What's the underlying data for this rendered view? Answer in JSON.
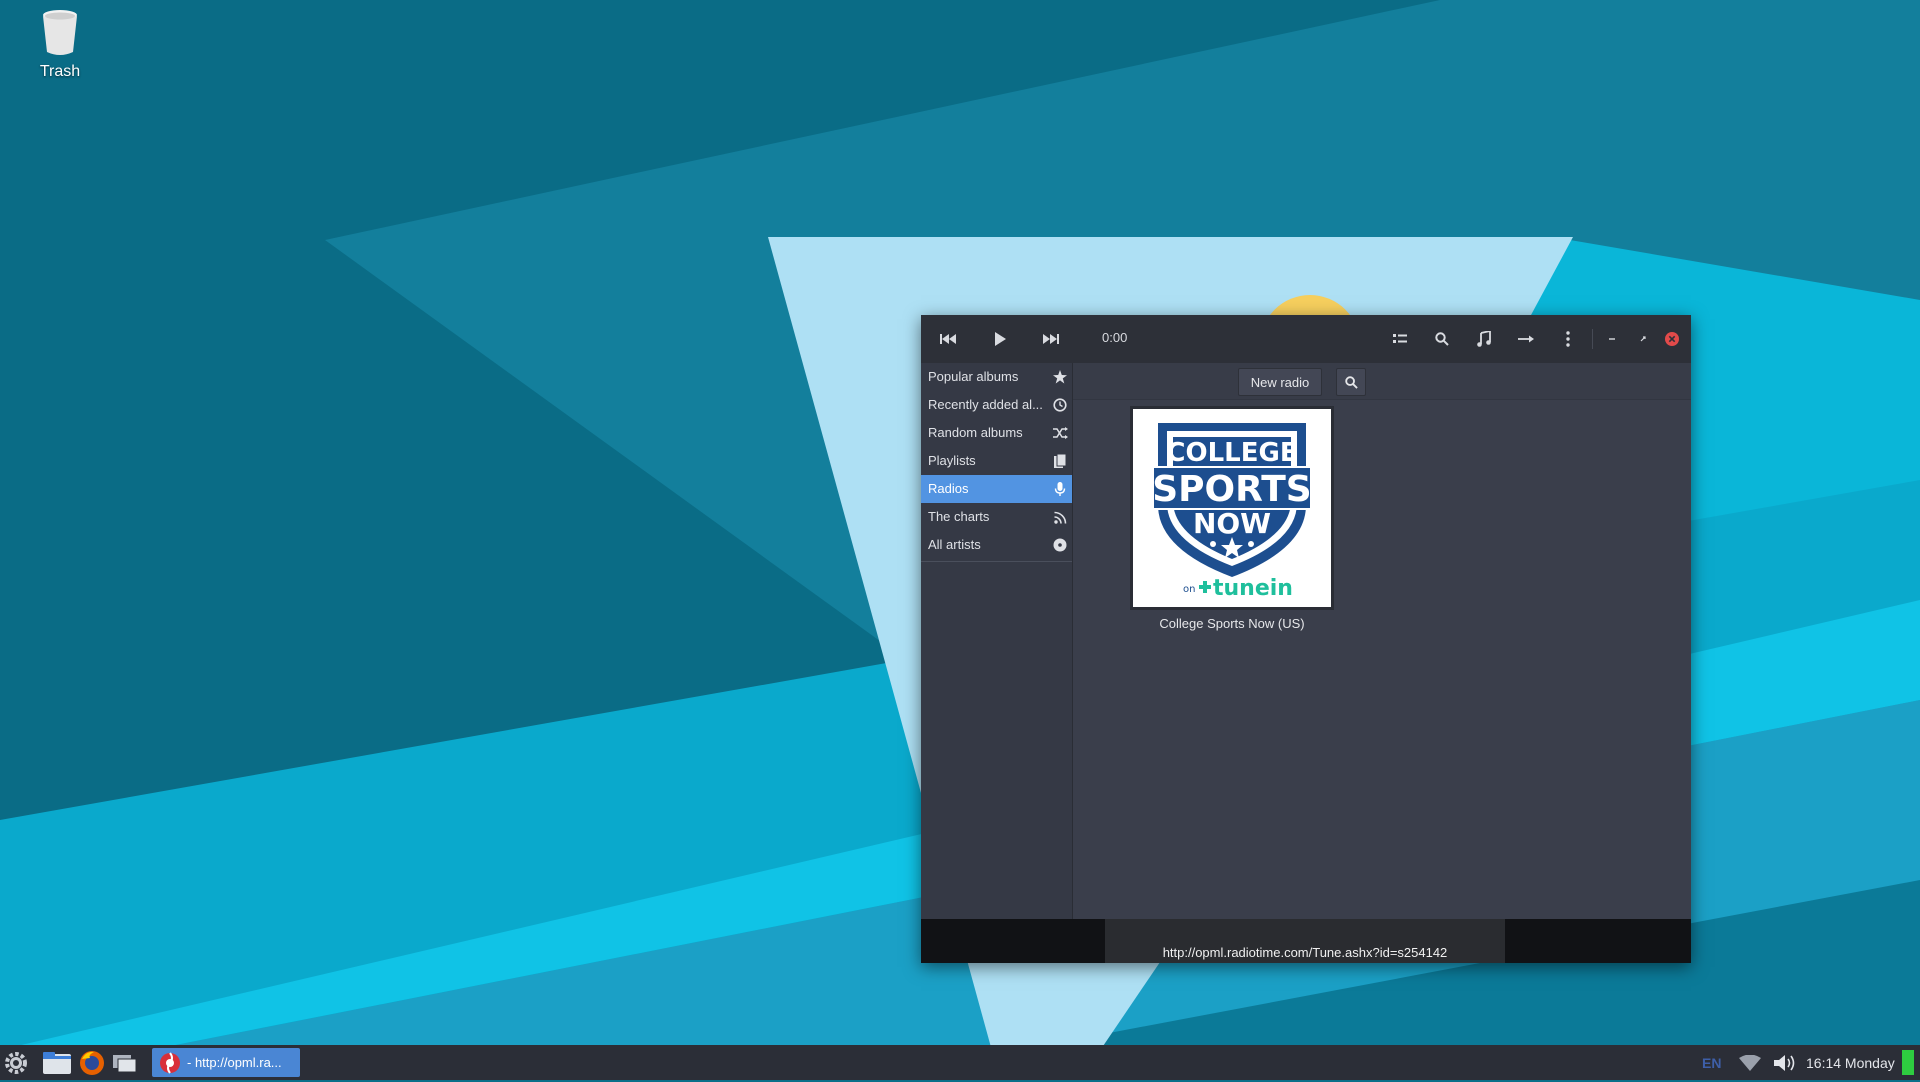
{
  "desktop": {
    "trash_label": "Trash"
  },
  "player": {
    "time": "0:00",
    "sidebar": [
      {
        "label": "Popular albums",
        "icon": "star-icon"
      },
      {
        "label": "Recently added al...",
        "icon": "clock-icon"
      },
      {
        "label": "Random albums",
        "icon": "shuffle-icon"
      },
      {
        "label": "Playlists",
        "icon": "documents-icon"
      },
      {
        "label": "Radios",
        "icon": "microphone-icon",
        "active": true
      },
      {
        "label": "The charts",
        "icon": "rss-icon"
      },
      {
        "label": "All artists",
        "icon": "disc-icon"
      }
    ],
    "toolbar": {
      "new_radio_label": "New radio"
    },
    "radio": {
      "title": "College Sports Now (US)",
      "logo_line1": "COLLEGE",
      "logo_line2": "SPORTS",
      "logo_line3": "NOW",
      "logo_on": "on",
      "logo_brand": "tunein"
    },
    "status_url": "http://opml.radiotime.com/Tune.ashx?id=s254142"
  },
  "taskbar": {
    "active_app_label": "- http://opml.ra...",
    "keyboard_layout": "EN",
    "clock": "16:14 Monday"
  },
  "colors": {
    "accent": "#5294e2",
    "close": "#e24a4a",
    "tunein_green": "#1fbf9c",
    "logo_blue": "#1d4e8f"
  }
}
